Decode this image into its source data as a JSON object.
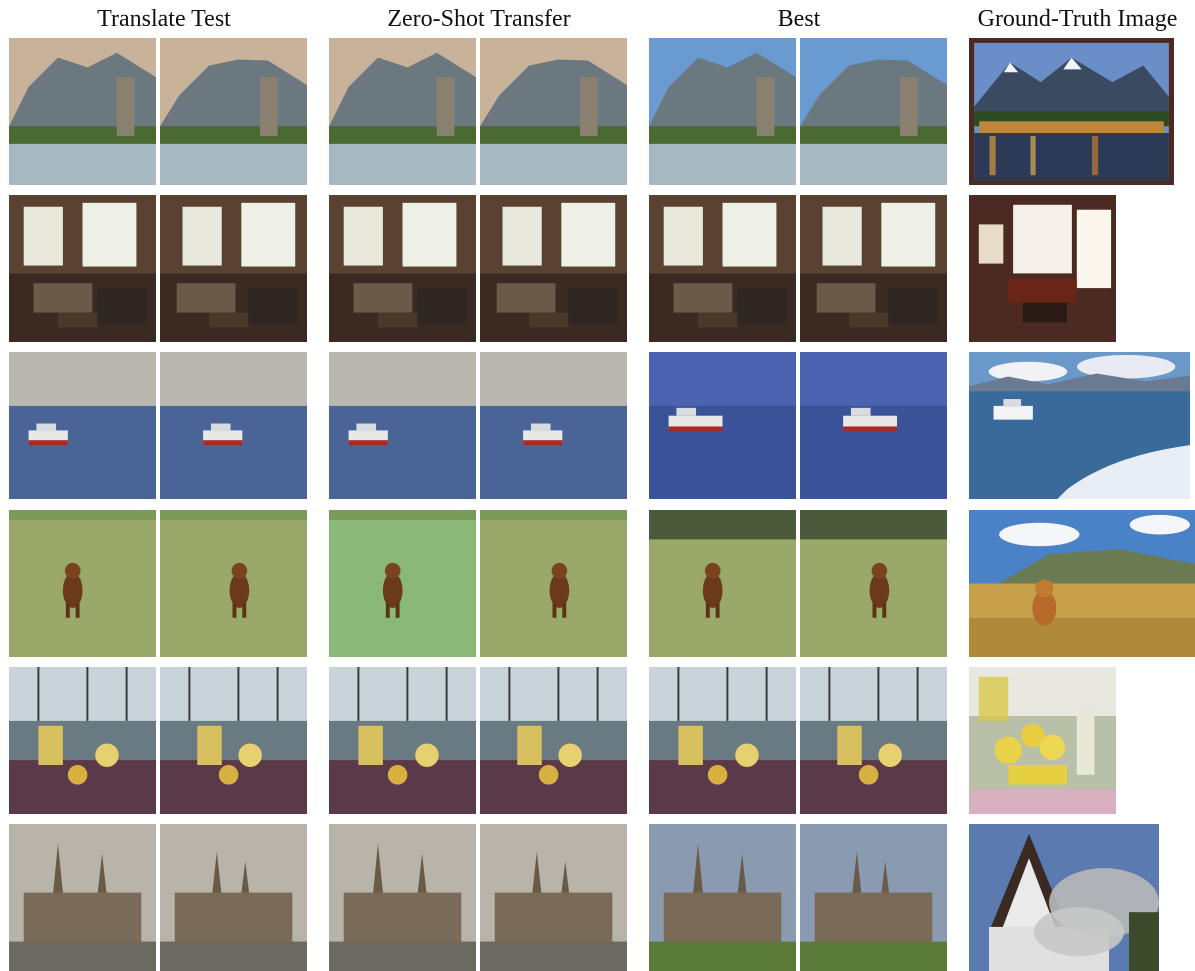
{
  "headers": {
    "translate_test": "Translate Test",
    "zero_shot": "Zero-Shot Transfer",
    "best": "Best",
    "ground_truth": "Ground-Truth Image"
  },
  "rows": [
    {
      "scene": "mountain-lake"
    },
    {
      "scene": "living-room"
    },
    {
      "scene": "boat-on-water"
    },
    {
      "scene": "dog-in-field"
    },
    {
      "scene": "lemonade-table"
    },
    {
      "scene": "church-ruins"
    }
  ]
}
